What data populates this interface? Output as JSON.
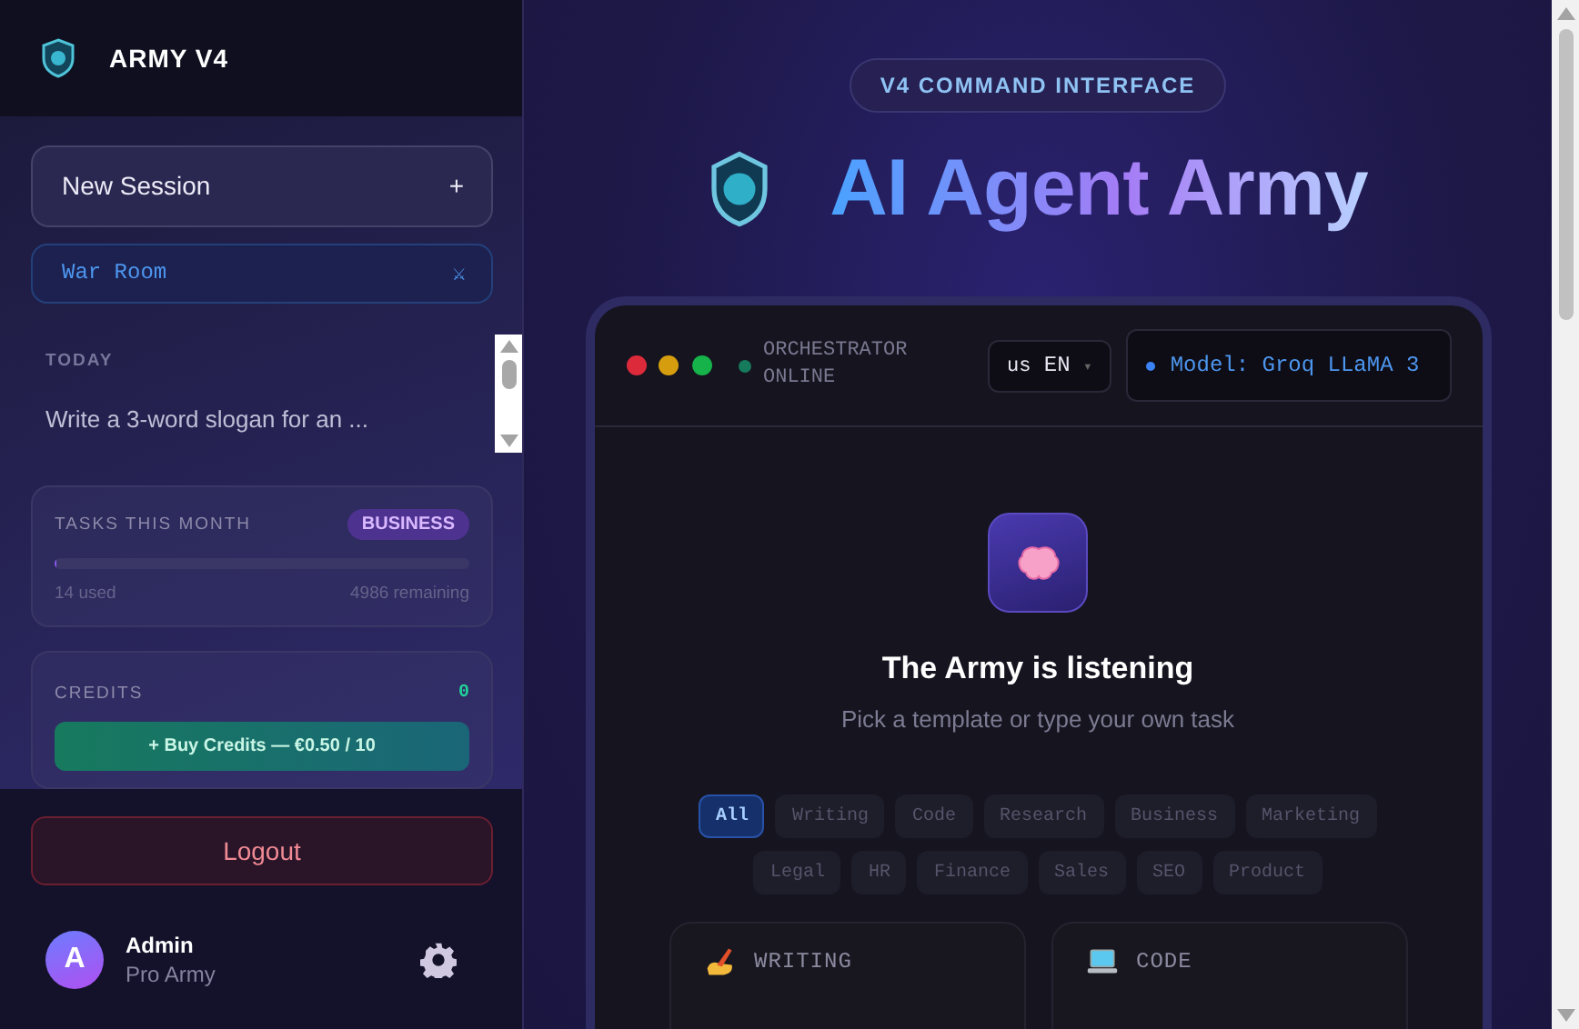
{
  "sidebar": {
    "brand": "ARMY V4",
    "new_session": {
      "label": "New Session",
      "icon": "+"
    },
    "war_room": {
      "label": "War Room",
      "icon": "⚔"
    },
    "history_group": "TODAY",
    "history": [
      {
        "title": "Write a 3-word slogan for an ..."
      }
    ],
    "tasks": {
      "label": "TASKS THIS MONTH",
      "plan": "BUSINESS",
      "level": 0.003,
      "used": "14 used",
      "remaining": "4986 remaining"
    },
    "credits": {
      "label": "CREDITS",
      "value": "0",
      "buy": "+ Buy Credits — €0.50 / 10"
    },
    "logout": "Logout",
    "user": {
      "initial": "A",
      "name": "Admin",
      "role": "Pro Army"
    }
  },
  "main": {
    "badge": "V4 COMMAND INTERFACE",
    "title": "AI Agent Army",
    "console": {
      "status": "ORCHESTRATOR ONLINE",
      "language": {
        "flag": "us",
        "code": "EN",
        "caret": "▾"
      },
      "model": "Model: Groq LLaMA 3",
      "heading": "The Army is listening",
      "subtitle": "Pick a template or type your own task",
      "categories": [
        {
          "label": "All",
          "selected": true
        },
        {
          "label": "Writing",
          "selected": false
        },
        {
          "label": "Code",
          "selected": false
        },
        {
          "label": "Research",
          "selected": false
        },
        {
          "label": "Business",
          "selected": false
        },
        {
          "label": "Marketing",
          "selected": false
        },
        {
          "label": "Legal",
          "selected": false
        },
        {
          "label": "HR",
          "selected": false
        },
        {
          "label": "Finance",
          "selected": false
        },
        {
          "label": "Sales",
          "selected": false
        },
        {
          "label": "SEO",
          "selected": false
        },
        {
          "label": "Product",
          "selected": false
        }
      ],
      "templates": [
        {
          "kind": "writing",
          "title": "WRITING"
        },
        {
          "kind": "code",
          "title": "CODE"
        }
      ]
    }
  }
}
